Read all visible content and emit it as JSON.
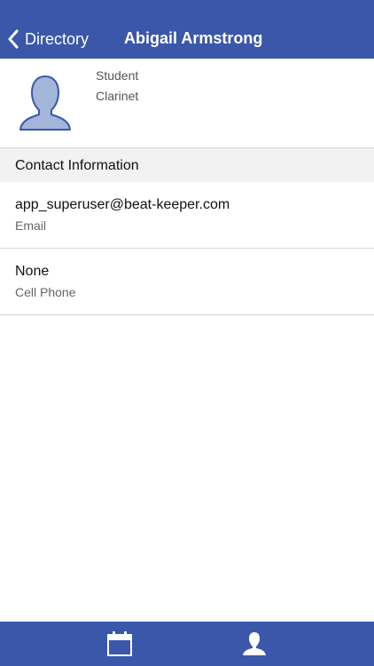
{
  "nav": {
    "back_label": "Directory",
    "title": "Abigail Armstrong"
  },
  "profile": {
    "role": "Student",
    "instrument": "Clarinet",
    "avatar_icon": "person-silhouette-icon"
  },
  "contact": {
    "section_title": "Contact Information",
    "rows": [
      {
        "value": "app_superuser@beat-keeper.com",
        "label": "Email"
      },
      {
        "value": "None",
        "label": "Cell Phone"
      }
    ]
  },
  "tabbar": {
    "tabs": [
      {
        "icon": "calendar-icon"
      },
      {
        "icon": "person-icon"
      }
    ]
  },
  "colors": {
    "brand": "#3a57a9",
    "avatar_fill": "#a3b5d8",
    "avatar_stroke": "#3a57a9"
  }
}
